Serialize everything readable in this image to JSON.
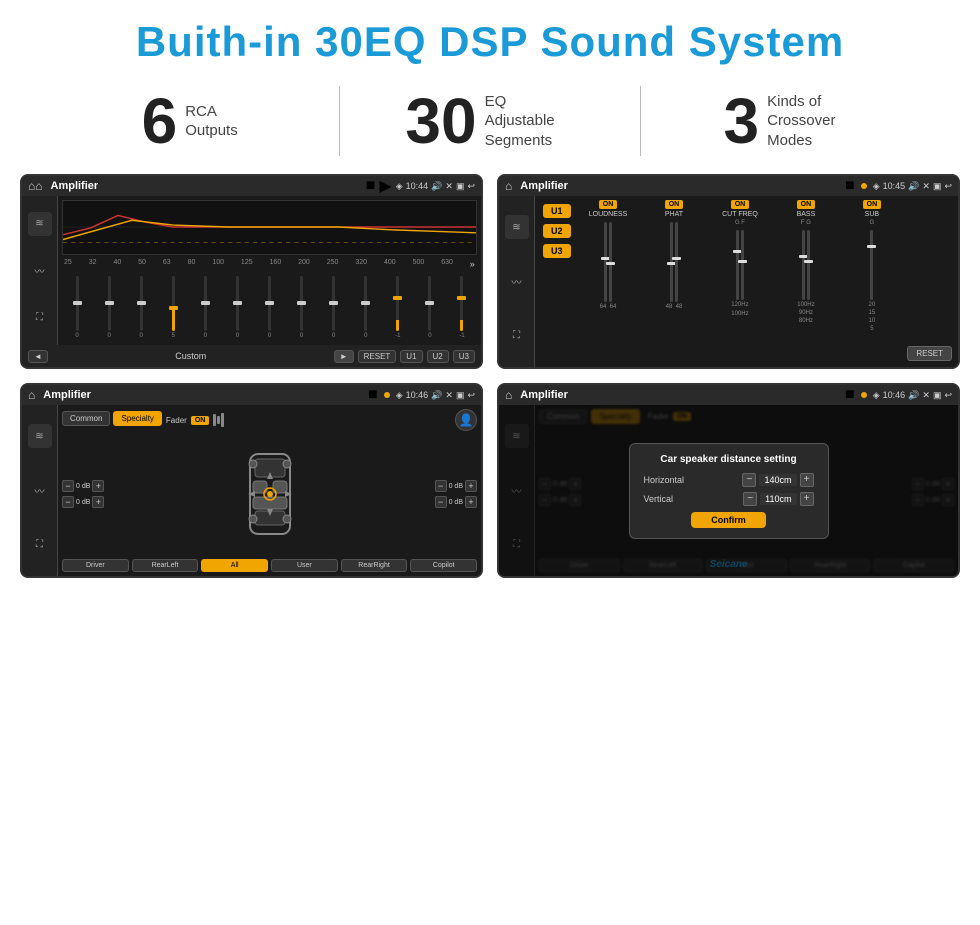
{
  "page": {
    "title": "Buith-in 30EQ DSP Sound System",
    "watermark": "Seicane"
  },
  "stats": [
    {
      "number": "6",
      "label": "RCA\nOutputs"
    },
    {
      "number": "30",
      "label": "EQ Adjustable\nSegments"
    },
    {
      "number": "3",
      "label": "Kinds of\nCrossover Modes"
    }
  ],
  "screens": {
    "eq": {
      "title": "Amplifier",
      "time": "10:44",
      "freq_labels": [
        "25",
        "32",
        "40",
        "50",
        "63",
        "80",
        "100",
        "125",
        "160",
        "200",
        "250",
        "320",
        "400",
        "500",
        "630"
      ],
      "slider_values": [
        "0",
        "0",
        "0",
        "5",
        "0",
        "0",
        "0",
        "0",
        "0",
        "0",
        "-1",
        "0",
        "-1"
      ],
      "bottom_buttons": [
        "Custom",
        "RESET",
        "U1",
        "U2",
        "U3"
      ]
    },
    "amp_right": {
      "title": "Amplifier",
      "time": "10:45",
      "channels": [
        "LOUDNESS",
        "PHAT",
        "CUT FREQ",
        "BASS",
        "SUB"
      ],
      "u_labels": [
        "U1",
        "U2",
        "U3"
      ],
      "reset_label": "RESET"
    },
    "speaker": {
      "title": "Amplifier",
      "time": "10:46",
      "tabs": [
        "Common",
        "Specialty"
      ],
      "fader_label": "Fader",
      "on_label": "ON",
      "bottom_buttons": [
        "Driver",
        "RearLeft",
        "All",
        "User",
        "RearRight",
        "Copilot"
      ]
    },
    "dialog": {
      "title": "Amplifier",
      "time": "10:46",
      "tabs": [
        "Common",
        "Specialty"
      ],
      "modal": {
        "title": "Car speaker distance setting",
        "horizontal_label": "Horizontal",
        "horizontal_value": "140cm",
        "vertical_label": "Vertical",
        "vertical_value": "110cm",
        "confirm_label": "Confirm"
      },
      "bottom_buttons": [
        "Driver",
        "RearLeft",
        "User",
        "RearRight",
        "Copilot"
      ]
    }
  }
}
